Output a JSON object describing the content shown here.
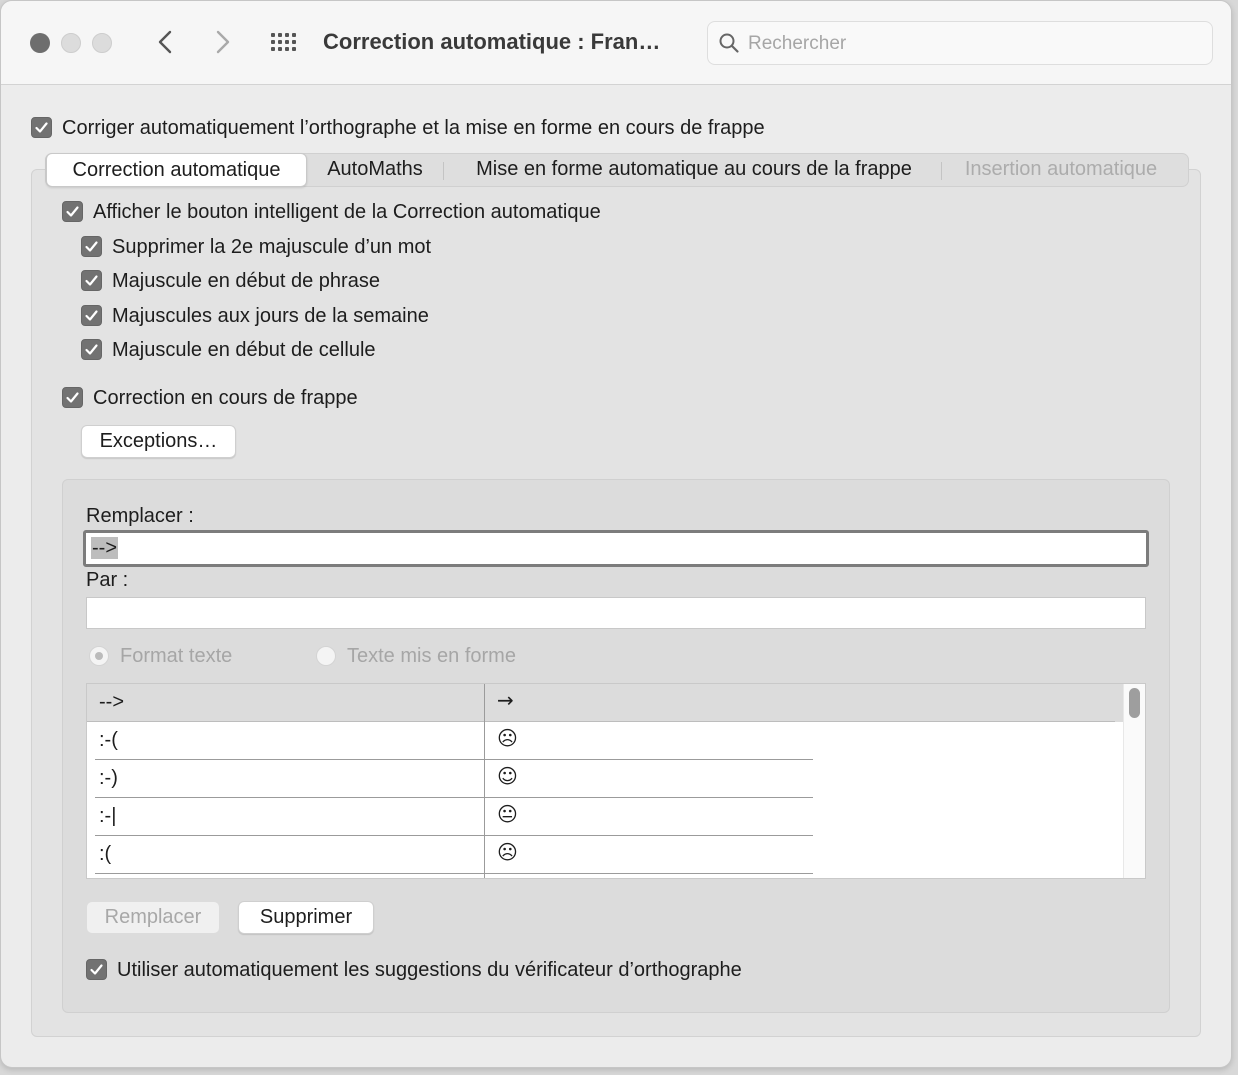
{
  "window": {
    "title": "Correction automatique : Fran…",
    "search_placeholder": "Rechercher"
  },
  "main_checkbox": {
    "label": "Corriger automatiquement l’orthographe et la mise en forme en cours de frappe",
    "checked": true
  },
  "tabs": [
    {
      "label": "Correction automatique",
      "active": true,
      "enabled": true
    },
    {
      "label": "AutoMaths",
      "active": false,
      "enabled": true
    },
    {
      "label": "Mise en forme automatique au cours de la frappe",
      "active": false,
      "enabled": true
    },
    {
      "label": "Insertion automatique",
      "active": false,
      "enabled": false
    }
  ],
  "options": {
    "smart_button": {
      "label": "Afficher le bouton intelligent de la Correction automatique",
      "checked": true
    },
    "sub_options": [
      {
        "label": "Supprimer la 2e majuscule d’un mot",
        "checked": true
      },
      {
        "label": "Majuscule en début de phrase",
        "checked": true
      },
      {
        "label": "Majuscules aux jours de la semaine",
        "checked": true
      },
      {
        "label": "Majuscule en début de cellule",
        "checked": true
      }
    ],
    "correct_while_typing": {
      "label": "Correction en cours de frappe",
      "checked": true
    },
    "exceptions_button": "Exceptions…"
  },
  "replace_panel": {
    "replace_label": "Remplacer :",
    "replace_value": "-->",
    "with_label": "Par :",
    "with_value": "",
    "format_options": [
      {
        "label": "Format texte",
        "selected": true
      },
      {
        "label": "Texte mis en forme",
        "selected": false
      }
    ],
    "entries": [
      {
        "replace": "-->",
        "with": "→",
        "selected": true
      },
      {
        "replace": ":-(",
        "with": "☹",
        "selected": false
      },
      {
        "replace": ":-)",
        "with": "☺",
        "selected": false
      },
      {
        "replace": ":-|",
        "with": "😐",
        "selected": false
      },
      {
        "replace": ":(",
        "with": "☹",
        "selected": false
      },
      {
        "replace": ":)",
        "with": "☺",
        "selected": false
      }
    ],
    "replace_button": "Remplacer",
    "delete_button": "Supprimer",
    "spell_suggestions": {
      "label": "Utiliser automatiquement les suggestions du vérificateur d’orthographe",
      "checked": true
    }
  }
}
